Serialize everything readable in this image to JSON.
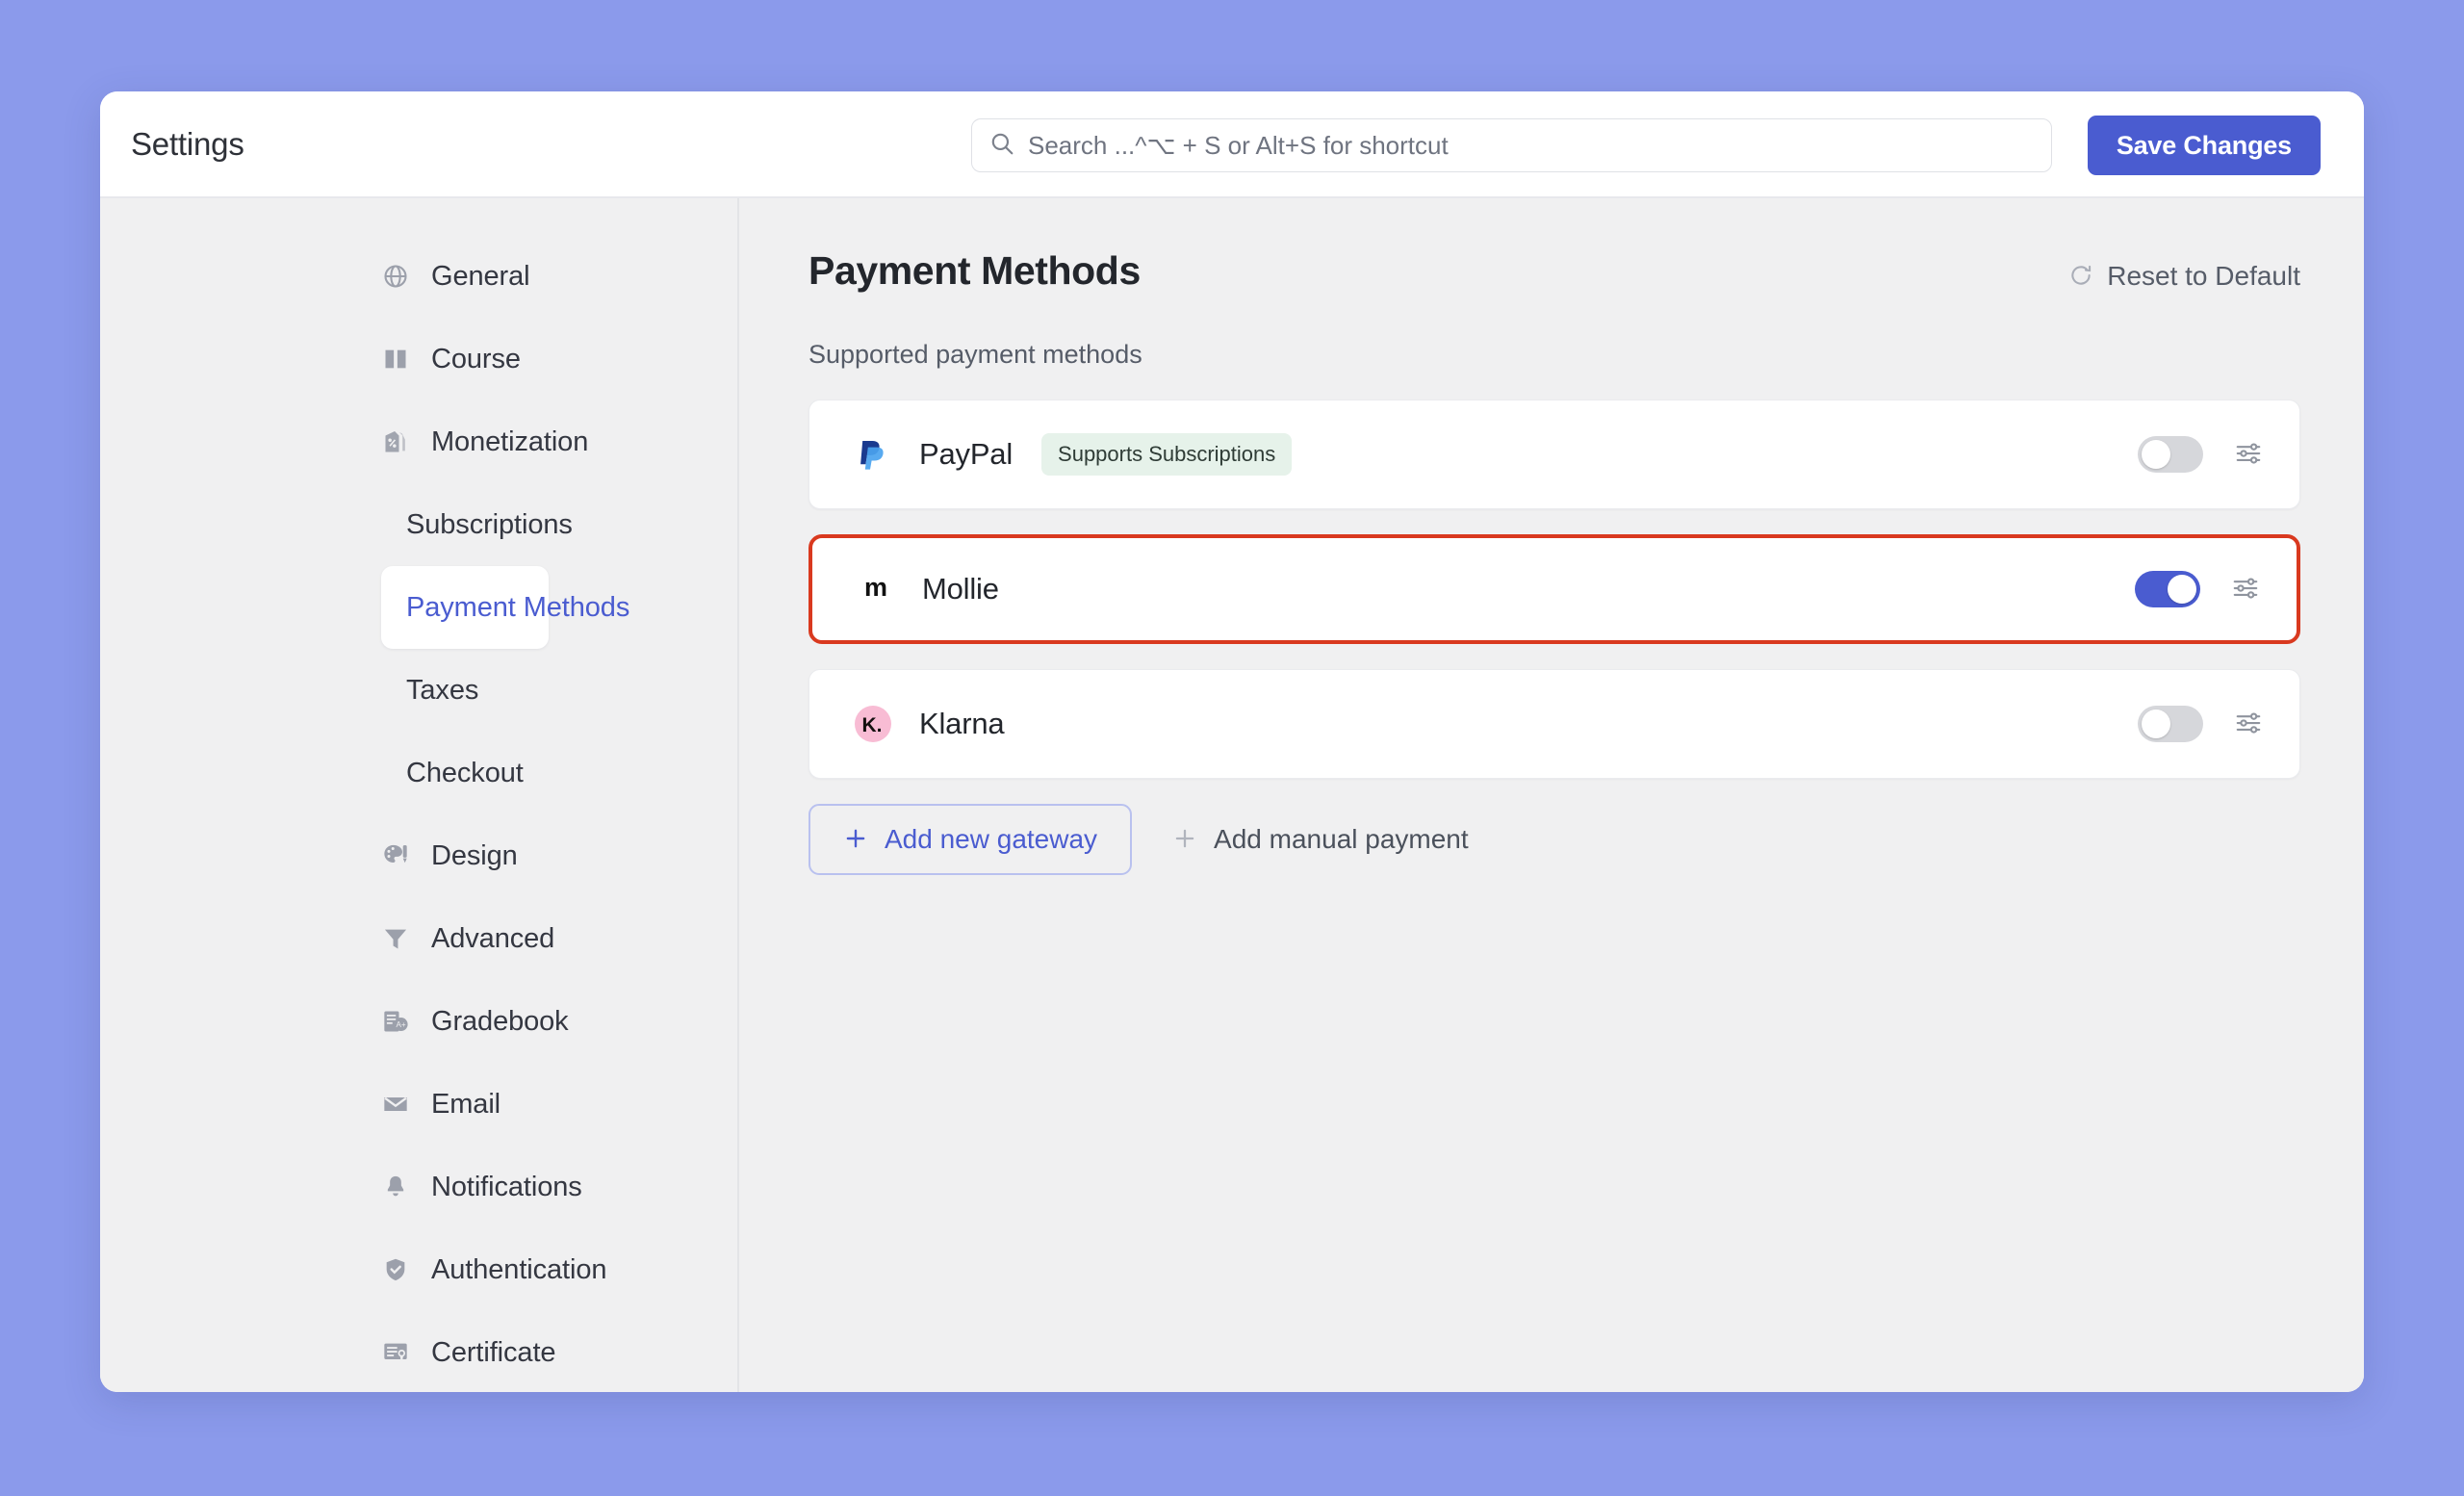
{
  "window": {
    "title": "Settings",
    "accent_color": "#4a5cd0",
    "page_background": "#8b9aeb",
    "highlight_border_color": "#d9391f"
  },
  "search": {
    "placeholder": "Search ...^⌥ + S or Alt+S for shortcut",
    "value": "",
    "icon": "search-icon"
  },
  "toolbar": {
    "save_label": "Save Changes"
  },
  "sidebar": {
    "items": [
      {
        "label": "General",
        "icon": "globe-icon",
        "type": "top",
        "active": false
      },
      {
        "label": "Course",
        "icon": "book-icon",
        "type": "top",
        "active": false
      },
      {
        "label": "Monetization",
        "icon": "tag-percent-icon",
        "type": "top",
        "active": false
      },
      {
        "label": "Subscriptions",
        "icon": "",
        "type": "sub",
        "active": false
      },
      {
        "label": "Payment Methods",
        "icon": "",
        "type": "sub",
        "active": true
      },
      {
        "label": "Taxes",
        "icon": "",
        "type": "sub",
        "active": false
      },
      {
        "label": "Checkout",
        "icon": "",
        "type": "sub",
        "active": false
      },
      {
        "label": "Design",
        "icon": "palette-icon",
        "type": "top",
        "active": false
      },
      {
        "label": "Advanced",
        "icon": "funnel-icon",
        "type": "top",
        "active": false
      },
      {
        "label": "Gradebook",
        "icon": "gradebook-icon",
        "type": "top",
        "active": false
      },
      {
        "label": "Email",
        "icon": "envelope-icon",
        "type": "top",
        "active": false
      },
      {
        "label": "Notifications",
        "icon": "bell-icon",
        "type": "top",
        "active": false
      },
      {
        "label": "Authentication",
        "icon": "shield-check-icon",
        "type": "top",
        "active": false
      },
      {
        "label": "Certificate",
        "icon": "certificate-icon",
        "type": "top",
        "active": false
      }
    ]
  },
  "main": {
    "title": "Payment Methods",
    "reset_label": "Reset to Default",
    "reset_icon": "refresh-icon",
    "section_subtitle": "Supported payment methods",
    "gateways": [
      {
        "name": "PayPal",
        "logo": "paypal-logo",
        "badge": "Supports Subscriptions",
        "badge_bg": "#e6f2ea",
        "enabled": false,
        "highlighted": false,
        "settings_icon": "sliders-icon"
      },
      {
        "name": "Mollie",
        "logo": "mollie-logo",
        "badge": "",
        "badge_bg": "",
        "enabled": true,
        "highlighted": true,
        "settings_icon": "sliders-icon"
      },
      {
        "name": "Klarna",
        "logo": "klarna-logo",
        "badge": "",
        "badge_bg": "",
        "enabled": false,
        "highlighted": false,
        "settings_icon": "sliders-icon"
      }
    ],
    "add_gateway_label": "Add new gateway",
    "add_manual_label": "Add manual payment"
  }
}
